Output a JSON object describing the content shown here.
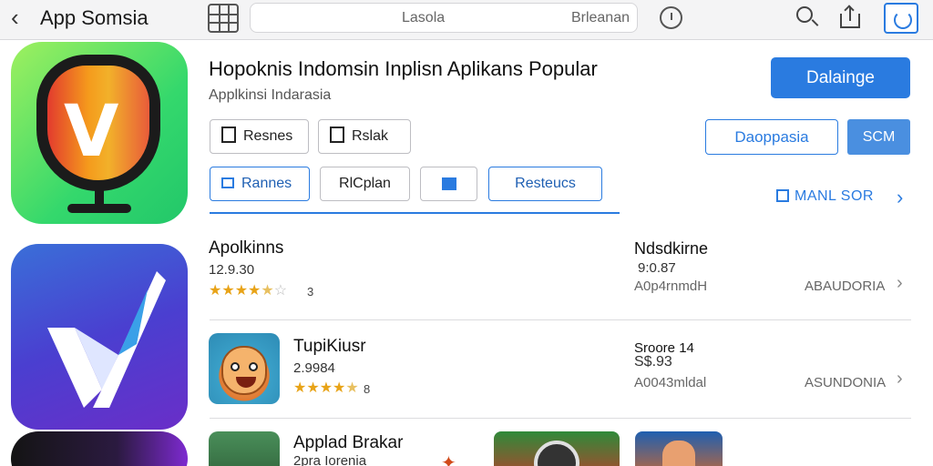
{
  "header": {
    "app_title": "App Somsia",
    "search_placeholder": "Lasola",
    "search_right": "Brleanan"
  },
  "hero": {
    "title": "Hopoknis Indomsin Inplisn Aplikans Popular",
    "subtitle": "Applkinsi Indarasia",
    "get_label": "Dalainge",
    "buttons": [
      "Resnes",
      "Rslak"
    ],
    "tabs": [
      "Rannes",
      "RlCplan",
      "",
      "Resteucs"
    ],
    "outline_label": "Daoppasia",
    "small_label": "SCM",
    "more_label": "MANL SOR"
  },
  "rows": [
    {
      "title": "Apolkinns",
      "version": "12.9.30",
      "rating": 4.5,
      "star_count": "3",
      "mid_title": "Ndsdkirne",
      "mid_value": "9:0.87",
      "mid_sub": "A0p4rnmdH",
      "right_label": "ABAUDORIA"
    },
    {
      "title": "TupiKiusr",
      "version": "2.9984",
      "rating": 4.5,
      "star_count": "8",
      "mid_title": "Sroore 14",
      "mid_value": "S$.93",
      "mid_sub": "A0043mldal",
      "right_label": "ASUNDONIA"
    },
    {
      "title": "Applad Brakar",
      "version": "2pra Iorenia"
    }
  ],
  "colors": {
    "accent": "#2a7be0",
    "star": "#e8a317"
  }
}
